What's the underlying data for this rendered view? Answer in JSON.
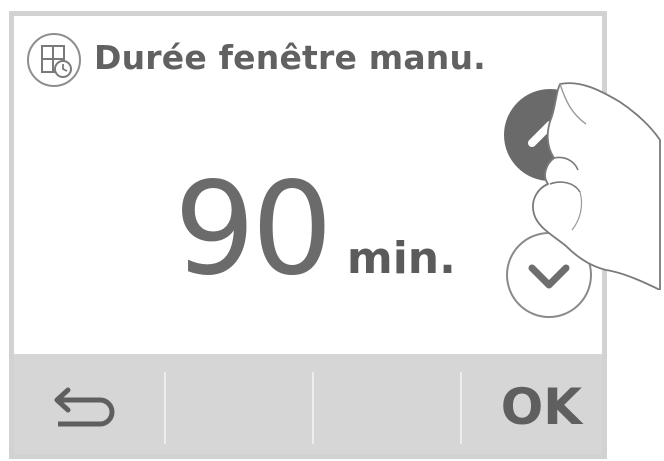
{
  "header": {
    "icon": "window-timer-icon",
    "title": "Durée fenêtre manu."
  },
  "value": {
    "number": "90",
    "unit": "min."
  },
  "controls": {
    "up_icon": "chevron-up-icon",
    "down_icon": "chevron-down-icon"
  },
  "footer": {
    "back_icon": "back-arrow-icon",
    "ok_label": "OK"
  },
  "colors": {
    "frame": "#d2d2d2",
    "text": "#616161",
    "footer_bg": "#d6d6d6",
    "up_button_bg": "#6a6a6a"
  }
}
